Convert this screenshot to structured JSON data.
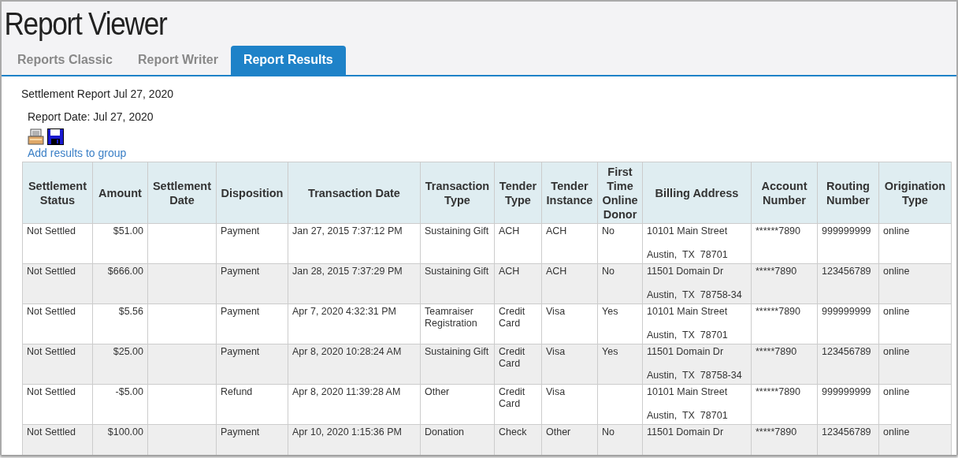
{
  "window": {
    "title": "Report Viewer"
  },
  "tabs": [
    {
      "label": "Reports Classic",
      "selected": false
    },
    {
      "label": "Report Writer",
      "selected": false
    },
    {
      "label": "Report Results",
      "selected": true
    }
  ],
  "report": {
    "title": "Settlement Report Jul 27, 2020",
    "report_date": "Report Date: Jul 27, 2020",
    "link": "Add results to group"
  },
  "table": {
    "columns": [
      {
        "label": "Settlement Status"
      },
      {
        "label": "Amount",
        "kind": "amount"
      },
      {
        "label": "Settlement Date"
      },
      {
        "label": "Disposition"
      },
      {
        "label": "Transaction Date"
      },
      {
        "label": "Transaction Type"
      },
      {
        "label": "Tender Type"
      },
      {
        "label": "Tender Instance"
      },
      {
        "label": "First Time Online Donor"
      },
      {
        "label": "Billing Address"
      },
      {
        "label": "Account Number"
      },
      {
        "label": "Routing Number"
      },
      {
        "label": "Origination Type"
      }
    ],
    "rows": [
      [
        "Not Settled",
        "$51.00",
        null,
        "Payment",
        "Jan 27, 2015 7:37:12 PM",
        "Sustaining Gift",
        "ACH",
        "ACH",
        "No",
        [
          "10101 Main Street",
          "Austin,  TX  78701"
        ],
        "******7890",
        "999999999",
        "online"
      ],
      [
        "Not Settled",
        "$666.00",
        null,
        "Payment",
        "Jan 28, 2015 7:37:29 PM",
        "Sustaining Gift",
        "ACH",
        "ACH",
        "No",
        [
          "11501 Domain Dr",
          "Austin,  TX  78758-34"
        ],
        "*****7890",
        "123456789",
        "online"
      ],
      [
        "Not Settled",
        "$5.56",
        null,
        "Payment",
        "Apr 7, 2020 4:32:31 PM",
        "Teamraiser Registration",
        "Credit Card",
        "Visa",
        "Yes",
        [
          "10101 Main Street",
          "Austin,  TX  78701"
        ],
        "******7890",
        "999999999",
        "online"
      ],
      [
        "Not Settled",
        "$25.00",
        null,
        "Payment",
        "Apr 8, 2020 10:28:24 AM",
        "Sustaining Gift",
        "Credit Card",
        "Visa",
        "Yes",
        [
          "11501 Domain Dr",
          "Austin,  TX  78758-34"
        ],
        "*****7890",
        "123456789",
        "online"
      ],
      [
        "Not Settled",
        "-$5.00",
        null,
        "Refund",
        "Apr 8, 2020 11:39:28 AM",
        "Other",
        "Credit Card",
        "Visa",
        null,
        [
          "10101 Main Street",
          "Austin,  TX  78701"
        ],
        "******7890",
        "999999999",
        "online"
      ],
      [
        "Not Settled",
        "$100.00",
        null,
        "Payment",
        "Apr 10, 2020 1:15:36 PM",
        "Donation",
        "Check",
        "Other",
        "No",
        [
          "11501 Domain Dr"
        ],
        "*****7890",
        "123456789",
        "online"
      ]
    ]
  }
}
